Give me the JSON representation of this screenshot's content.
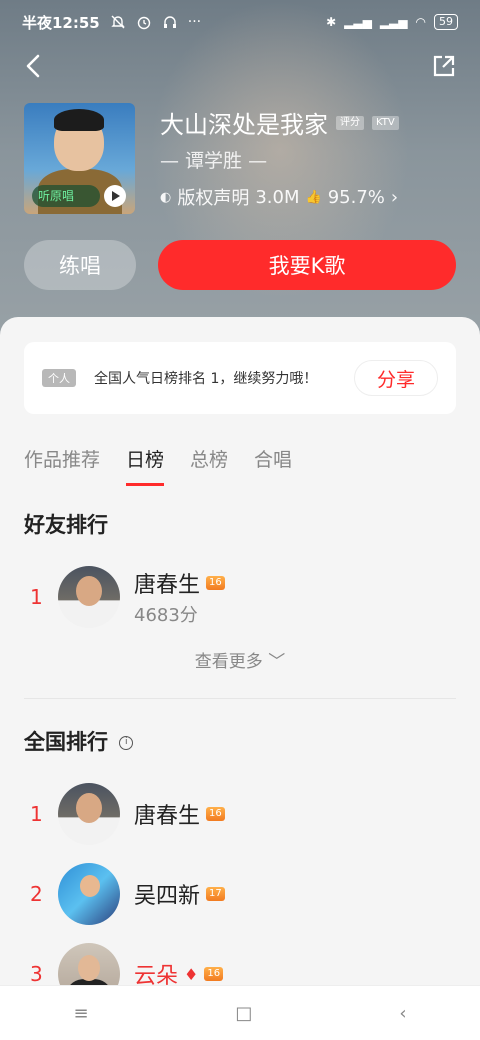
{
  "status_bar": {
    "time": "半夜12:55",
    "icons": [
      "mute-icon",
      "alarm-icon",
      "headset-icon"
    ],
    "dots": "···",
    "battery": "59"
  },
  "song": {
    "title": "大山深处是我家",
    "tag_score": "评分",
    "tag_ktv": "KTV",
    "singer": "— 谭学胜 —",
    "copyright": "版权声明",
    "plays": "3.0M",
    "rating": "95.7%",
    "cover_badge": "听原唱"
  },
  "actions": {
    "practice": "练唱",
    "sing": "我要K歌"
  },
  "notice": {
    "badge": "个人",
    "text": "全国人气日榜排名 1，继续努力哦！",
    "share": "分享"
  },
  "tabs": [
    {
      "label": "作品推荐",
      "active": false
    },
    {
      "label": "日榜",
      "active": true
    },
    {
      "label": "总榜",
      "active": false
    },
    {
      "label": "合唱",
      "active": false
    }
  ],
  "friends": {
    "title": "好友排行",
    "rows": [
      {
        "rank": "1",
        "name": "唐春生",
        "level": "16",
        "score": "4683分"
      }
    ],
    "more": "查看更多"
  },
  "national": {
    "title": "全国排行",
    "rows": [
      {
        "rank": "1",
        "name": "唐春生",
        "level": "16"
      },
      {
        "rank": "2",
        "name": "吴四新",
        "level": "17"
      },
      {
        "rank": "3",
        "name": "云朵",
        "level": "16"
      }
    ]
  },
  "sysnav": {
    "menu": "≡",
    "home": "□",
    "back": "‹"
  },
  "colors": {
    "accent": "#ff2b2b",
    "rank_red": "#e33"
  }
}
